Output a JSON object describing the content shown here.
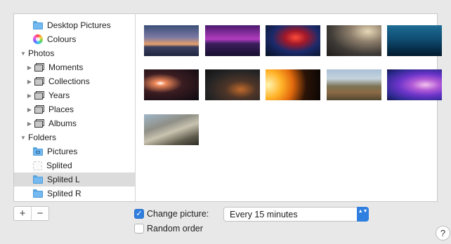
{
  "sidebar": {
    "items": [
      {
        "label": "Desktop Pictures",
        "icon": "folder-icon",
        "level": 2
      },
      {
        "label": "Colours",
        "icon": "color-wheel-icon",
        "level": 2
      },
      {
        "label": "Photos",
        "icon": "disclosure-open-icon",
        "level": 0
      },
      {
        "label": "Moments",
        "icon": "photo-stack-icon",
        "level": 1
      },
      {
        "label": "Collections",
        "icon": "photo-stack-icon",
        "level": 1
      },
      {
        "label": "Years",
        "icon": "photo-stack-icon",
        "level": 1
      },
      {
        "label": "Places",
        "icon": "photo-stack-icon",
        "level": 1
      },
      {
        "label": "Albums",
        "icon": "photo-stack-icon",
        "level": 1
      },
      {
        "label": "Folders",
        "icon": "disclosure-open-icon",
        "level": 0
      },
      {
        "label": "Pictures",
        "icon": "pictures-folder-icon",
        "level": 2
      },
      {
        "label": "Splited",
        "icon": "blank-folder-icon",
        "level": 2
      },
      {
        "label": "Splited L",
        "icon": "folder-icon",
        "level": 2,
        "selected": true
      },
      {
        "label": "Splited R",
        "icon": "folder-icon",
        "level": 2
      }
    ],
    "add_label": "+",
    "remove_label": "−"
  },
  "gallery": {
    "thumbnails": [
      {
        "name": "thumb-dusk-mountains"
      },
      {
        "name": "thumb-purple-city"
      },
      {
        "name": "thumb-red-nebula"
      },
      {
        "name": "thumb-ruins-light"
      },
      {
        "name": "thumb-blue-underwater"
      },
      {
        "name": "thumb-planet-flare"
      },
      {
        "name": "thumb-dark-volcano"
      },
      {
        "name": "thumb-sun-planets"
      },
      {
        "name": "thumb-valley-trail"
      },
      {
        "name": "thumb-purple-abstract"
      },
      {
        "name": "thumb-yosemite"
      }
    ]
  },
  "options": {
    "change_picture_label": "Change picture:",
    "change_picture_checked": true,
    "interval_value": "Every 15 minutes",
    "random_order_label": "Random order",
    "random_order_checked": false,
    "help_label": "?",
    "check_mark": "✓",
    "stepper_glyph": "▲▼"
  },
  "colors": {
    "accent": "#2f7fe0",
    "selection": "#dcdcdc",
    "background": "#e8e8e8"
  }
}
